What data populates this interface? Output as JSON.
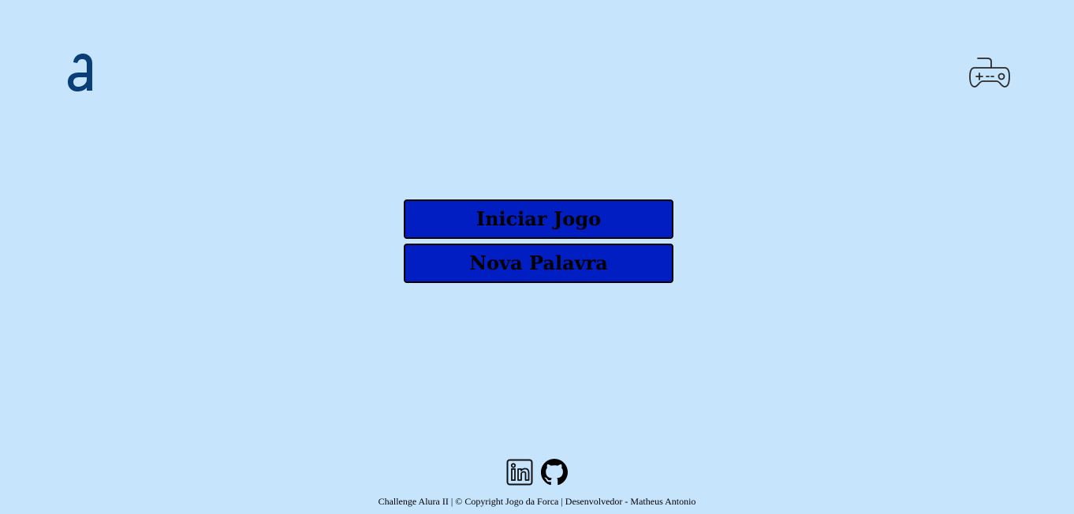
{
  "header": {
    "logo_icon": "alura-logo-icon",
    "controller_icon": "gamepad-icon"
  },
  "menu": {
    "start_label": "Iniciar Jogo",
    "new_word_label": "Nova Palavra"
  },
  "footer": {
    "social_icons": [
      "linkedin-icon",
      "github-icon"
    ],
    "text": "Challenge Alura II | © Copyright Jogo da Forca | Desenvolvedor - Matheus Antonio"
  },
  "colors": {
    "background": "#c7e4fd",
    "button": "#001ec2",
    "logo": "#0b3e76",
    "icon": "#111111"
  }
}
